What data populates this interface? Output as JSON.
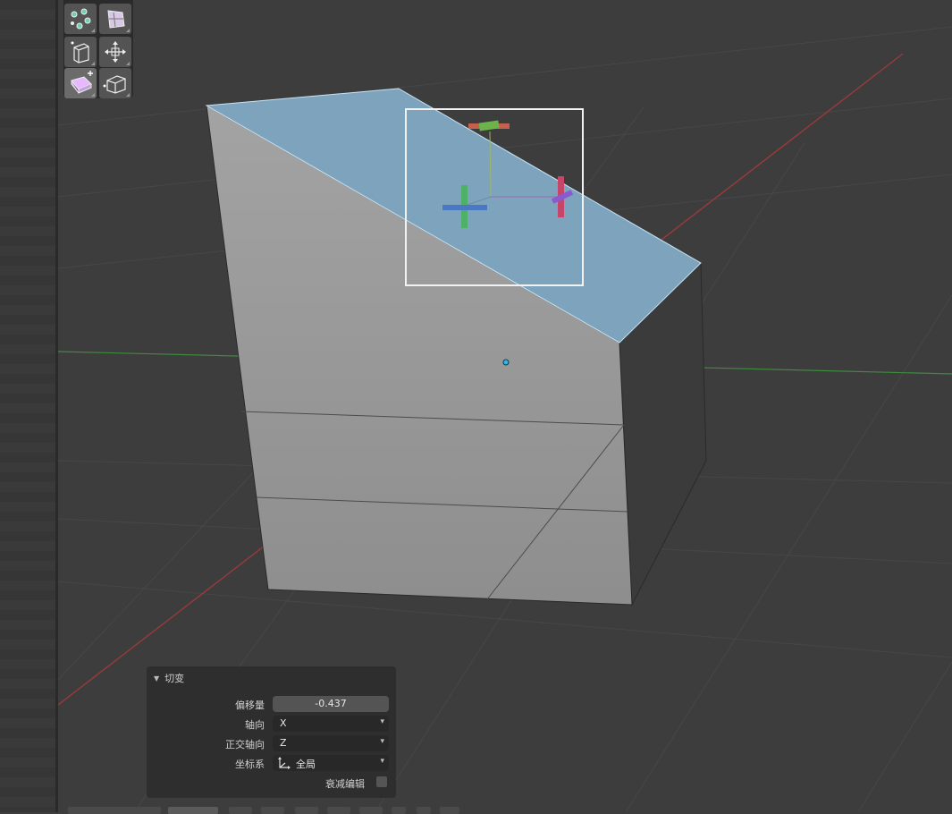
{
  "colors": {
    "viewport_bg": "#3d3d3d",
    "face_selected": "#7ea4bd",
    "mesh_face": "#9a9a9a",
    "axis_x": "#9b3a3a",
    "axis_y": "#3f8a3f",
    "select_box": "#ffffff"
  },
  "toolbar": {
    "tools": [
      {
        "icon": "random-vertices-icon"
      },
      {
        "icon": "shrink-fatten-icon"
      },
      {
        "icon": "push-pull-icon"
      },
      {
        "icon": "to-sphere-icon"
      },
      {
        "icon": "shear-icon",
        "active": true
      },
      {
        "icon": "rip-region-icon"
      }
    ]
  },
  "operator_panel": {
    "title": "切变",
    "offset_label": "偏移量",
    "offset_value": "-0.437",
    "axis_label": "轴向",
    "axis_value": "X",
    "ortho_axis_label": "正交轴向",
    "ortho_axis_value": "Z",
    "orientation_label": "坐标系",
    "orientation_value": "全局",
    "proportional_label": "衰减编辑",
    "proportional_checked": false
  }
}
